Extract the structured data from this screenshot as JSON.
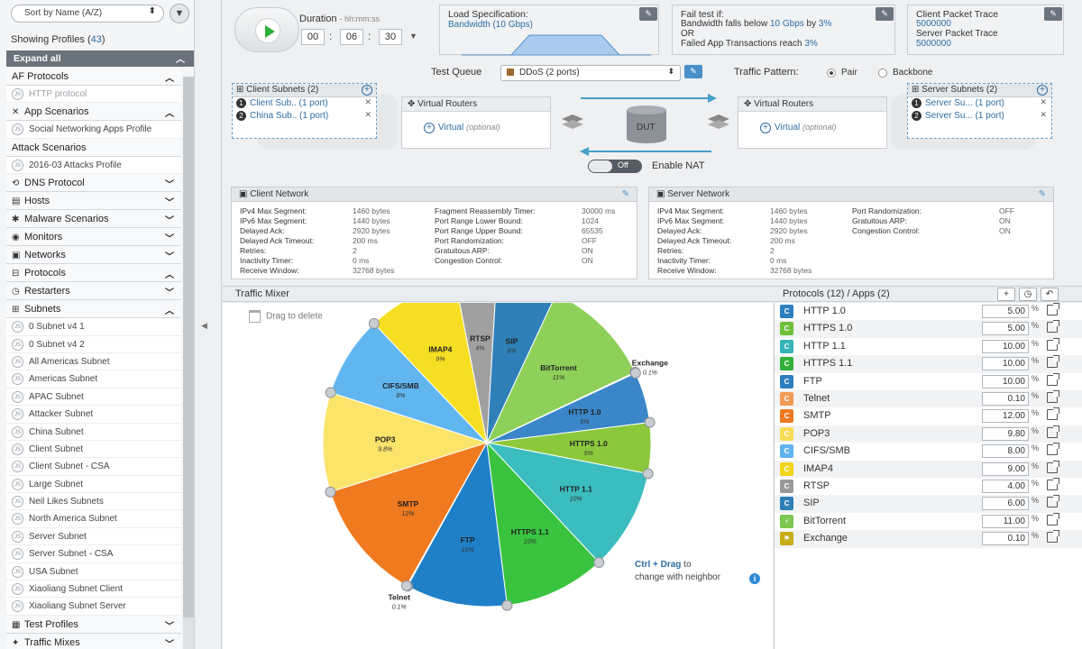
{
  "sidebar": {
    "sort_label": "Sort by Name (A/Z)",
    "showing_prefix": "Showing Profiles (",
    "showing_count": "43",
    "showing_suffix": ")",
    "expand_all": "Expand all",
    "entries": [
      {
        "kind": "cat",
        "label": "AF Protocols",
        "icon": "",
        "chev": "up"
      },
      {
        "kind": "item",
        "label": "HTTP protocol",
        "dim": true
      },
      {
        "kind": "cat",
        "label": "App Scenarios",
        "icon": "tools-icon",
        "chev": "up"
      },
      {
        "kind": "item",
        "label": "Social Networking Apps Profile"
      },
      {
        "kind": "cat",
        "label": "Attack Scenarios",
        "icon": "",
        "chev": ""
      },
      {
        "kind": "item",
        "label": "2016-03 Attacks Profile"
      },
      {
        "kind": "cat",
        "label": "DNS Protocol",
        "icon": "dns-icon",
        "chev": "down"
      },
      {
        "kind": "cat",
        "label": "Hosts",
        "icon": "hosts-icon",
        "chev": "down"
      },
      {
        "kind": "cat",
        "label": "Malware Scenarios",
        "icon": "bug-icon",
        "chev": "down"
      },
      {
        "kind": "cat",
        "label": "Monitors",
        "icon": "monitor-icon",
        "chev": "down"
      },
      {
        "kind": "cat",
        "label": "Networks",
        "icon": "network-icon",
        "chev": "down"
      },
      {
        "kind": "cat",
        "label": "Protocols",
        "icon": "protocol-icon",
        "chev": "up"
      },
      {
        "kind": "cat",
        "label": "Restarters",
        "icon": "clock-icon",
        "chev": "down"
      },
      {
        "kind": "cat",
        "label": "Subnets",
        "icon": "subnet-icon",
        "chev": "up"
      },
      {
        "kind": "item",
        "label": "0 Subnet v4 1"
      },
      {
        "kind": "item",
        "label": "0 Subnet v4 2"
      },
      {
        "kind": "item",
        "label": "All Americas Subnet"
      },
      {
        "kind": "item",
        "label": "Americas Subnet"
      },
      {
        "kind": "item",
        "label": "APAC Subnet"
      },
      {
        "kind": "item",
        "label": "Attacker Subnet"
      },
      {
        "kind": "item",
        "label": "China Subnet"
      },
      {
        "kind": "item",
        "label": "Client Subnet"
      },
      {
        "kind": "item",
        "label": "Client Subnet - CSA"
      },
      {
        "kind": "item",
        "label": "Large Subnet"
      },
      {
        "kind": "item",
        "label": "Neil Likes Subnets"
      },
      {
        "kind": "item",
        "label": "North America Subnet"
      },
      {
        "kind": "item",
        "label": "Server Subnet"
      },
      {
        "kind": "item",
        "label": "Server Subnet - CSA"
      },
      {
        "kind": "item",
        "label": "USA Subnet"
      },
      {
        "kind": "item",
        "label": "Xiaoliang Subnet Client"
      },
      {
        "kind": "item",
        "label": "Xiaoliang Subnet Server"
      },
      {
        "kind": "cat",
        "label": "Test Profiles",
        "icon": "test-icon",
        "chev": "down"
      },
      {
        "kind": "cat",
        "label": "Traffic Mixes",
        "icon": "mix-icon",
        "chev": "down"
      }
    ]
  },
  "controls": {
    "duration_label": "Duration",
    "duration_format": "- hh:mm:ss",
    "hours": "00",
    "minutes": "06",
    "seconds": "30"
  },
  "load_spec": {
    "title": "Load Specification:",
    "value": "Bandwidth (10 Gbps)"
  },
  "fail_test": {
    "title": "Fail test if:",
    "line1_prefix": "Bandwidth falls below ",
    "line1_val1": "10 Gbps",
    "line1_mid": " by ",
    "line1_val2": "3%",
    "or": "OR",
    "line3_prefix": "Failed App Transactions reach ",
    "line3_val": "3%"
  },
  "packet_trace": {
    "client_label": "Client Packet Trace",
    "client_value": "5000000",
    "server_label": "Server Packet Trace",
    "server_value": "5000000"
  },
  "topology": {
    "test_queue_label": "Test Queue",
    "test_queue_value": "DDoS (2 ports)",
    "traffic_pattern_label": "Traffic Pattern:",
    "pair_label": "Pair",
    "backbone_label": "Backbone",
    "client_subnets_title": "Client Subnets (2)",
    "client_subnets": [
      {
        "num": "1",
        "name": "Client Sub..",
        "ports": "(1 port)"
      },
      {
        "num": "2",
        "name": "China Sub..",
        "ports": "(1 port)"
      }
    ],
    "server_subnets_title": "Server Subnets (2)",
    "server_subnets": [
      {
        "num": "1",
        "name": "Server Su...",
        "ports": "(1 port)"
      },
      {
        "num": "2",
        "name": "Server Su...",
        "ports": "(1 port)"
      }
    ],
    "vr_title": "Virtual Routers",
    "vr_link": "Virtual",
    "vr_optional": "(optional)",
    "dut_label": "DUT",
    "nat_toggle": "Off",
    "nat_label": "Enable NAT"
  },
  "client_network": {
    "title": "Client Network",
    "left": [
      {
        "k": "IPv4 Max Segment:",
        "v": "1460 bytes"
      },
      {
        "k": "IPv6 Max Segment:",
        "v": "1440 bytes"
      },
      {
        "k": "Delayed Ack:",
        "v": "2920 bytes"
      },
      {
        "k": "Delayed Ack Timeout:",
        "v": "200 ms"
      },
      {
        "k": "Retries:",
        "v": "2"
      },
      {
        "k": "Inactivity Timer:",
        "v": "0 ms"
      },
      {
        "k": "Receive Window:",
        "v": "32768 bytes"
      }
    ],
    "right": [
      {
        "k": "Fragment Reassembly Timer:",
        "v": "30000 ms"
      },
      {
        "k": "Port Range Lower Bound:",
        "v": "1024"
      },
      {
        "k": "Port Range Upper Bound:",
        "v": "65535"
      },
      {
        "k": "Port Randomization:",
        "v": "OFF"
      },
      {
        "k": "Gratuitous ARP:",
        "v": "ON"
      },
      {
        "k": "Congestion Control:",
        "v": "ON"
      }
    ]
  },
  "server_network": {
    "title": "Server Network",
    "left": [
      {
        "k": "IPv4 Max Segment:",
        "v": "1460 bytes"
      },
      {
        "k": "IPv6 Max Segment:",
        "v": "1440 bytes"
      },
      {
        "k": "Delayed Ack:",
        "v": "2920 bytes"
      },
      {
        "k": "Delayed Ack Timeout:",
        "v": "200 ms"
      },
      {
        "k": "Retries:",
        "v": "2"
      },
      {
        "k": "Inactivity Timer:",
        "v": "0 ms"
      },
      {
        "k": "Receive Window:",
        "v": "32768 bytes"
      }
    ],
    "right": [
      {
        "k": "Port Randomization:",
        "v": "OFF"
      },
      {
        "k": "Gratuitous ARP:",
        "v": "ON"
      },
      {
        "k": "Congestion Control:",
        "v": "ON"
      }
    ]
  },
  "mixer": {
    "title": "Traffic Mixer",
    "drag_delete": "Drag to delete",
    "hint_key": "Ctrl + Drag",
    "hint_rest1": " to",
    "hint_rest2": "change with neighbor",
    "protocols_title": "Protocols (12) / Apps (2)",
    "percent_sign": "%"
  },
  "chart_data": {
    "type": "pie",
    "start_label": "BitTorrent",
    "slices": [
      {
        "name": "BitTorrent",
        "value": 11,
        "label": "11%",
        "color": "#8ed05a"
      },
      {
        "name": "Exchange",
        "value": 0.1,
        "label": "0.1%",
        "color": "#c9b400"
      },
      {
        "name": "HTTP 1.0",
        "value": 5,
        "label": "5%",
        "color": "#3a86c8"
      },
      {
        "name": "HTTPS 1.0",
        "value": 5,
        "label": "5%",
        "color": "#8cc83c"
      },
      {
        "name": "HTTP 1.1",
        "value": 10,
        "label": "10%",
        "color": "#3bbcbf"
      },
      {
        "name": "HTTPS 1.1",
        "value": 10,
        "label": "10%",
        "color": "#39c33f"
      },
      {
        "name": "FTP",
        "value": 10,
        "label": "10%",
        "color": "#1f80c8"
      },
      {
        "name": "Telnet",
        "value": 0.1,
        "label": "0.1%",
        "color": "#f08030"
      },
      {
        "name": "SMTP",
        "value": 12,
        "label": "12%",
        "color": "#f07a1f"
      },
      {
        "name": "POP3",
        "value": 9.8,
        "label": "9.8%",
        "color": "#fbe46a"
      },
      {
        "name": "CIFS/SMB",
        "value": 8,
        "label": "8%",
        "color": "#62b6f0"
      },
      {
        "name": "IMAP4",
        "value": 9,
        "label": "9%",
        "color": "#f6df22"
      },
      {
        "name": "RTSP",
        "value": 4,
        "label": "4%",
        "color": "#a0a0a0"
      },
      {
        "name": "SIP",
        "value": 6,
        "label": "6%",
        "color": "#2f80b8"
      }
    ]
  },
  "protocols": [
    {
      "name": "HTTP 1.0",
      "value": "5.00",
      "color": "#2e7fc0"
    },
    {
      "name": "HTTPS 1.0",
      "value": "5.00",
      "color": "#6fbf3a"
    },
    {
      "name": "HTTP 1.1",
      "value": "10.00",
      "color": "#36b4b8"
    },
    {
      "name": "HTTPS 1.1",
      "value": "10.00",
      "color": "#33b03a"
    },
    {
      "name": "FTP",
      "value": "10.00",
      "color": "#2e7fc0"
    },
    {
      "name": "Telnet",
      "value": "0.10",
      "color": "#f29a55"
    },
    {
      "name": "SMTP",
      "value": "12.00",
      "color": "#ee7a22"
    },
    {
      "name": "POP3",
      "value": "9.80",
      "color": "#f7dc56"
    },
    {
      "name": "CIFS/SMB",
      "value": "8.00",
      "color": "#5fb3ee"
    },
    {
      "name": "IMAP4",
      "value": "9.00",
      "color": "#f2d51e"
    },
    {
      "name": "RTSP",
      "value": "4.00",
      "color": "#9a9a9a"
    },
    {
      "name": "SIP",
      "value": "6.00",
      "color": "#2e7fb5"
    },
    {
      "name": "BitTorrent",
      "value": "11.00",
      "color": "#7cc850"
    },
    {
      "name": "Exchange",
      "value": "0.10",
      "color": "#c7ad1a"
    }
  ]
}
